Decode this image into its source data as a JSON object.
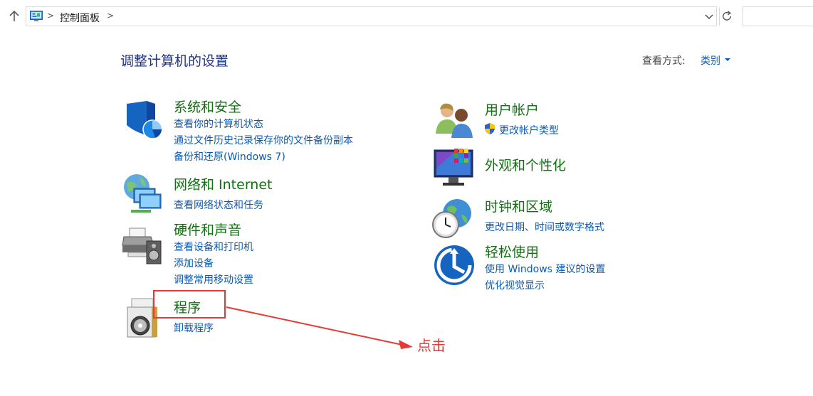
{
  "address_bar": {
    "breadcrumb": "控制面板",
    "separator": ">"
  },
  "header": {
    "title": "调整计算机的设置",
    "view_label": "查看方式:",
    "view_value": "类别"
  },
  "categories": {
    "system_security": {
      "title": "系统和安全",
      "links": [
        "查看你的计算机状态",
        "通过文件历史记录保存你的文件备份副本",
        "备份和还原(Windows 7)"
      ]
    },
    "network": {
      "title": "网络和 Internet",
      "links": [
        "查看网络状态和任务"
      ]
    },
    "hardware": {
      "title": "硬件和声音",
      "links": [
        "查看设备和打印机",
        "添加设备",
        "调整常用移动设置"
      ]
    },
    "programs": {
      "title": "程序",
      "links": [
        "卸载程序"
      ]
    },
    "user_accounts": {
      "title": "用户帐户",
      "links": [
        "更改帐户类型"
      ]
    },
    "appearance": {
      "title": "外观和个性化",
      "links": []
    },
    "clock_region": {
      "title": "时钟和区域",
      "links": [
        "更改日期、时间或数字格式"
      ]
    },
    "ease_of_access": {
      "title": "轻松使用",
      "links": [
        "使用 Windows 建议的设置",
        "优化视觉显示"
      ]
    }
  },
  "annotation": {
    "text": "点击",
    "color": "#e53935"
  },
  "colors": {
    "category_title": "#127012",
    "link": "#0b59b5",
    "page_title": "#1e3287"
  }
}
